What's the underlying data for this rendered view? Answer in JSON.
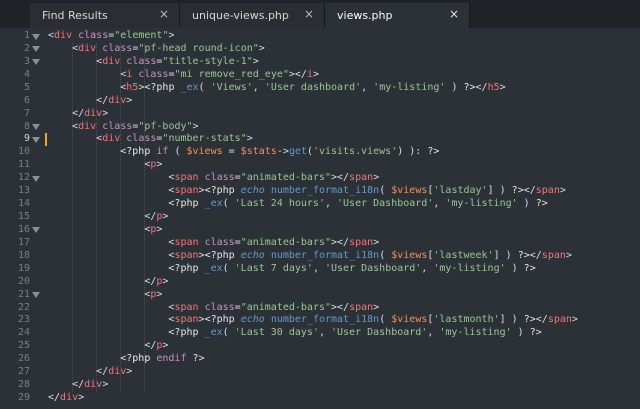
{
  "tabs": [
    {
      "label": "Find Results",
      "active": false,
      "close": "×"
    },
    {
      "label": "unique-views.php",
      "active": false,
      "close": "×"
    },
    {
      "label": "views.php",
      "active": true,
      "close": "×"
    }
  ],
  "gutter": {
    "current_line": 9,
    "fold_lines": [
      1,
      2,
      3,
      8,
      9,
      12,
      16,
      21
    ]
  },
  "code_lines": [
    [
      [
        "t-pun",
        "<"
      ],
      [
        "t-tag",
        "div"
      ],
      [
        "t-pun",
        " "
      ],
      [
        "t-attr",
        "class"
      ],
      [
        "t-pun",
        "="
      ],
      [
        "t-str",
        "\"element\""
      ],
      [
        "t-pun",
        ">"
      ]
    ],
    [
      [
        "t-pun",
        "    <"
      ],
      [
        "t-tag",
        "div"
      ],
      [
        "t-pun",
        " "
      ],
      [
        "t-attr",
        "class"
      ],
      [
        "t-pun",
        "="
      ],
      [
        "t-str",
        "\"pf-head round-icon\""
      ],
      [
        "t-pun",
        ">"
      ]
    ],
    [
      [
        "t-pun",
        "        <"
      ],
      [
        "t-tag",
        "div"
      ],
      [
        "t-pun",
        " "
      ],
      [
        "t-attr",
        "class"
      ],
      [
        "t-pun",
        "="
      ],
      [
        "t-str",
        "\"title-style-1\""
      ],
      [
        "t-pun",
        ">"
      ]
    ],
    [
      [
        "t-pun",
        "            <"
      ],
      [
        "t-tag",
        "i"
      ],
      [
        "t-pun",
        " "
      ],
      [
        "t-attr",
        "class"
      ],
      [
        "t-pun",
        "="
      ],
      [
        "t-str",
        "\"mi remove_red_eye\""
      ],
      [
        "t-pun",
        "></"
      ],
      [
        "t-tag",
        "i"
      ],
      [
        "t-pun",
        ">"
      ]
    ],
    [
      [
        "t-pun",
        "            <"
      ],
      [
        "t-tag",
        "h5"
      ],
      [
        "t-pun",
        ">"
      ],
      [
        "t-php",
        "<?php "
      ],
      [
        "t-fn",
        "_ex"
      ],
      [
        "t-pun",
        "( "
      ],
      [
        "t-str",
        "'Views'"
      ],
      [
        "t-pun",
        ", "
      ],
      [
        "t-str",
        "'User dashboard'"
      ],
      [
        "t-pun",
        ", "
      ],
      [
        "t-str",
        "'my-listing'"
      ],
      [
        "t-pun",
        " ) "
      ],
      [
        "t-php",
        "?>"
      ],
      [
        "t-pun",
        "</"
      ],
      [
        "t-tag",
        "h5"
      ],
      [
        "t-pun",
        ">"
      ]
    ],
    [
      [
        "t-pun",
        "        </"
      ],
      [
        "t-tag",
        "div"
      ],
      [
        "t-pun",
        ">"
      ]
    ],
    [
      [
        "t-pun",
        "    </"
      ],
      [
        "t-tag",
        "div"
      ],
      [
        "t-pun",
        ">"
      ]
    ],
    [
      [
        "t-pun",
        "    <"
      ],
      [
        "t-tag",
        "div"
      ],
      [
        "t-pun",
        " "
      ],
      [
        "t-attr",
        "class"
      ],
      [
        "t-pun",
        "="
      ],
      [
        "t-str",
        "\"pf-body\""
      ],
      [
        "t-pun",
        ">"
      ]
    ],
    [
      [
        "t-pun",
        "        <"
      ],
      [
        "t-tag",
        "div"
      ],
      [
        "t-pun",
        " "
      ],
      [
        "t-attr",
        "class"
      ],
      [
        "t-pun",
        "="
      ],
      [
        "t-str",
        "\"number-stats\""
      ],
      [
        "t-pun",
        ">"
      ]
    ],
    [
      [
        "t-php",
        "            <?php "
      ],
      [
        "t-kw",
        "if"
      ],
      [
        "t-pun",
        " ( "
      ],
      [
        "t-var",
        "$views"
      ],
      [
        "t-pun",
        " = "
      ],
      [
        "t-var",
        "$stats"
      ],
      [
        "t-pun",
        "->"
      ],
      [
        "t-fn",
        "get"
      ],
      [
        "t-pun",
        "("
      ],
      [
        "t-str",
        "'visits.views'"
      ],
      [
        "t-pun",
        ") ): "
      ],
      [
        "t-php",
        "?>"
      ]
    ],
    [
      [
        "t-pun",
        "                <"
      ],
      [
        "t-tag",
        "p"
      ],
      [
        "t-pun",
        ">"
      ]
    ],
    [
      [
        "t-pun",
        "                    <"
      ],
      [
        "t-tag",
        "span"
      ],
      [
        "t-pun",
        " "
      ],
      [
        "t-attr",
        "class"
      ],
      [
        "t-pun",
        "="
      ],
      [
        "t-str",
        "\"animated-bars\""
      ],
      [
        "t-pun",
        "></"
      ],
      [
        "t-tag",
        "span"
      ],
      [
        "t-pun",
        ">"
      ]
    ],
    [
      [
        "t-pun",
        "                    <"
      ],
      [
        "t-tag",
        "span"
      ],
      [
        "t-pun",
        ">"
      ],
      [
        "t-php",
        "<?php "
      ],
      [
        "t-it",
        "echo"
      ],
      [
        "t-pun",
        " "
      ],
      [
        "t-fn",
        "number_format_i18n"
      ],
      [
        "t-pun",
        "( "
      ],
      [
        "t-var",
        "$views"
      ],
      [
        "t-pun",
        "["
      ],
      [
        "t-str",
        "'lastday'"
      ],
      [
        "t-pun",
        "] ) "
      ],
      [
        "t-php",
        "?>"
      ],
      [
        "t-pun",
        "</"
      ],
      [
        "t-tag",
        "span"
      ],
      [
        "t-pun",
        ">"
      ]
    ],
    [
      [
        "t-php",
        "                    <?php "
      ],
      [
        "t-fn",
        "_ex"
      ],
      [
        "t-pun",
        "( "
      ],
      [
        "t-str",
        "'Last 24 hours'"
      ],
      [
        "t-pun",
        ", "
      ],
      [
        "t-str",
        "'User Dashboard'"
      ],
      [
        "t-pun",
        ", "
      ],
      [
        "t-str",
        "'my-listing'"
      ],
      [
        "t-pun",
        " ) "
      ],
      [
        "t-php",
        "?>"
      ]
    ],
    [
      [
        "t-pun",
        "                </"
      ],
      [
        "t-tag",
        "p"
      ],
      [
        "t-pun",
        ">"
      ]
    ],
    [
      [
        "t-pun",
        "                <"
      ],
      [
        "t-tag",
        "p"
      ],
      [
        "t-pun",
        ">"
      ]
    ],
    [
      [
        "t-pun",
        "                    <"
      ],
      [
        "t-tag",
        "span"
      ],
      [
        "t-pun",
        " "
      ],
      [
        "t-attr",
        "class"
      ],
      [
        "t-pun",
        "="
      ],
      [
        "t-str",
        "\"animated-bars\""
      ],
      [
        "t-pun",
        "></"
      ],
      [
        "t-tag",
        "span"
      ],
      [
        "t-pun",
        ">"
      ]
    ],
    [
      [
        "t-pun",
        "                    <"
      ],
      [
        "t-tag",
        "span"
      ],
      [
        "t-pun",
        ">"
      ],
      [
        "t-php",
        "<?php "
      ],
      [
        "t-it",
        "echo"
      ],
      [
        "t-pun",
        " "
      ],
      [
        "t-fn",
        "number_format_i18n"
      ],
      [
        "t-pun",
        "( "
      ],
      [
        "t-var",
        "$views"
      ],
      [
        "t-pun",
        "["
      ],
      [
        "t-str",
        "'lastweek'"
      ],
      [
        "t-pun",
        "] ) "
      ],
      [
        "t-php",
        "?>"
      ],
      [
        "t-pun",
        "</"
      ],
      [
        "t-tag",
        "span"
      ],
      [
        "t-pun",
        ">"
      ]
    ],
    [
      [
        "t-php",
        "                    <?php "
      ],
      [
        "t-fn",
        "_ex"
      ],
      [
        "t-pun",
        "( "
      ],
      [
        "t-str",
        "'Last 7 days'"
      ],
      [
        "t-pun",
        ", "
      ],
      [
        "t-str",
        "'User Dashboard'"
      ],
      [
        "t-pun",
        ", "
      ],
      [
        "t-str",
        "'my-listing'"
      ],
      [
        "t-pun",
        " ) "
      ],
      [
        "t-php",
        "?>"
      ]
    ],
    [
      [
        "t-pun",
        "                </"
      ],
      [
        "t-tag",
        "p"
      ],
      [
        "t-pun",
        ">"
      ]
    ],
    [
      [
        "t-pun",
        "                <"
      ],
      [
        "t-tag",
        "p"
      ],
      [
        "t-pun",
        ">"
      ]
    ],
    [
      [
        "t-pun",
        "                    <"
      ],
      [
        "t-tag",
        "span"
      ],
      [
        "t-pun",
        " "
      ],
      [
        "t-attr",
        "class"
      ],
      [
        "t-pun",
        "="
      ],
      [
        "t-str",
        "\"animated-bars\""
      ],
      [
        "t-pun",
        "></"
      ],
      [
        "t-tag",
        "span"
      ],
      [
        "t-pun",
        ">"
      ]
    ],
    [
      [
        "t-pun",
        "                    <"
      ],
      [
        "t-tag",
        "span"
      ],
      [
        "t-pun",
        ">"
      ],
      [
        "t-php",
        "<?php "
      ],
      [
        "t-it",
        "echo"
      ],
      [
        "t-pun",
        " "
      ],
      [
        "t-fn",
        "number_format_i18n"
      ],
      [
        "t-pun",
        "( "
      ],
      [
        "t-var",
        "$views"
      ],
      [
        "t-pun",
        "["
      ],
      [
        "t-str",
        "'lastmonth'"
      ],
      [
        "t-pun",
        "] ) "
      ],
      [
        "t-php",
        "?>"
      ],
      [
        "t-pun",
        "</"
      ],
      [
        "t-tag",
        "span"
      ],
      [
        "t-pun",
        ">"
      ]
    ],
    [
      [
        "t-php",
        "                    <?php "
      ],
      [
        "t-fn",
        "_ex"
      ],
      [
        "t-pun",
        "( "
      ],
      [
        "t-str",
        "'Last 30 days'"
      ],
      [
        "t-pun",
        ", "
      ],
      [
        "t-str",
        "'User Dashboard'"
      ],
      [
        "t-pun",
        ", "
      ],
      [
        "t-str",
        "'my-listing'"
      ],
      [
        "t-pun",
        " ) "
      ],
      [
        "t-php",
        "?>"
      ]
    ],
    [
      [
        "t-pun",
        "                </"
      ],
      [
        "t-tag",
        "p"
      ],
      [
        "t-pun",
        ">"
      ]
    ],
    [
      [
        "t-php",
        "            <?php "
      ],
      [
        "t-kw",
        "endif"
      ],
      [
        "t-pun",
        " "
      ],
      [
        "t-php",
        "?>"
      ]
    ],
    [
      [
        "t-pun",
        "        </"
      ],
      [
        "t-tag",
        "div"
      ],
      [
        "t-pun",
        ">"
      ]
    ],
    [
      [
        "t-pun",
        "    </"
      ],
      [
        "t-tag",
        "div"
      ],
      [
        "t-pun",
        ">"
      ]
    ],
    [
      [
        "t-pun",
        "</"
      ],
      [
        "t-tag",
        "div"
      ],
      [
        "t-pun",
        ">"
      ]
    ]
  ],
  "colors": {
    "editor_bg": "#2c3037",
    "tabbar_bg": "#1f2226",
    "tag": "#f2777a",
    "attribute": "#c594c5",
    "string": "#99c794",
    "function": "#6699cc",
    "variable": "#f99157",
    "caret_marker": "#f0a32f"
  }
}
